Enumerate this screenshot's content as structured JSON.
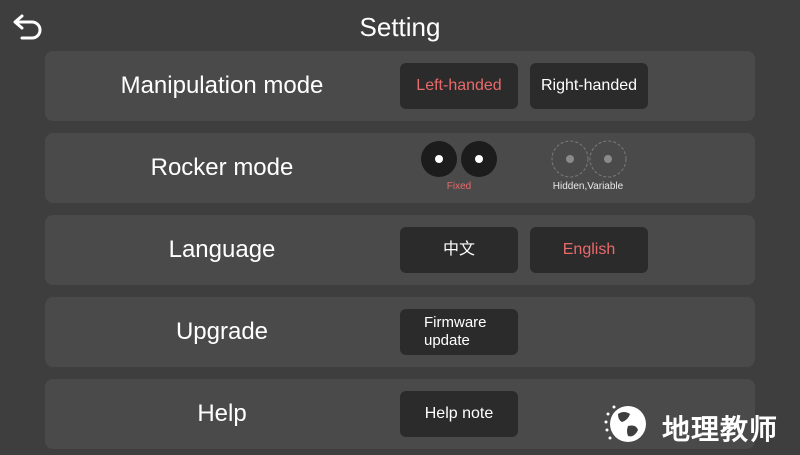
{
  "header": {
    "title": "Setting",
    "back_icon": "back-arrow-icon"
  },
  "settings": {
    "manipulation": {
      "label": "Manipulation mode",
      "options": [
        {
          "label": "Left-handed",
          "selected": true
        },
        {
          "label": "Right-handed",
          "selected": false
        }
      ]
    },
    "rocker": {
      "label": "Rocker mode",
      "options": [
        {
          "label": "Fixed",
          "selected": true
        },
        {
          "label": "Hidden,Variable",
          "selected": false
        }
      ]
    },
    "language": {
      "label": "Language",
      "options": [
        {
          "label": "中文",
          "selected": false
        },
        {
          "label": "English",
          "selected": true
        }
      ]
    },
    "upgrade": {
      "label": "Upgrade",
      "button": {
        "line1": "Firmware",
        "line2": "update"
      }
    },
    "help": {
      "label": "Help",
      "button": "Help note"
    }
  },
  "watermark": {
    "text": "地理教师"
  },
  "colors": {
    "background": "#3e3e3e",
    "row": "#4a4a4a",
    "button": "#2b2b2b",
    "accent": "#e86a6a",
    "text": "#ffffff"
  }
}
